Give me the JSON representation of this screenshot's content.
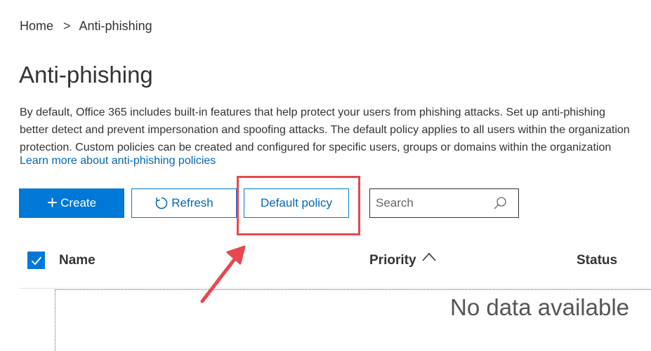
{
  "breadcrumb": {
    "home": "Home",
    "separator": ">",
    "current": "Anti-phishing"
  },
  "page": {
    "title": "Anti-phishing",
    "description_lines": [
      "By default, Office 365 includes built-in features that help protect your users from phishing attacks. Set up anti-phishing",
      "better detect and prevent impersonation and spoofing attacks. The default policy applies to all users within the organization",
      "protection. Custom policies can be created and configured for specific users, groups or domains within the organization"
    ],
    "learn_more_link": "Learn more about anti-phishing policies"
  },
  "toolbar": {
    "create_icon": "+",
    "create_label": "Create",
    "refresh_label": "Refresh",
    "refresh_icon": "refresh-icon",
    "default_policy_label": "Default policy",
    "search_placeholder": "Search",
    "search_icon": "search-icon"
  },
  "table": {
    "select_all_checked": true,
    "columns": {
      "name": "Name",
      "priority": "Priority",
      "status": "Status"
    },
    "sort_column": "priority",
    "sort_direction": "ascending",
    "empty_text": "No data available"
  },
  "annotation": {
    "highlight_color": "#e8474f",
    "arrow_color": "#e8474f"
  },
  "colors": {
    "accent": "#0078d7",
    "link": "#0067b8"
  }
}
